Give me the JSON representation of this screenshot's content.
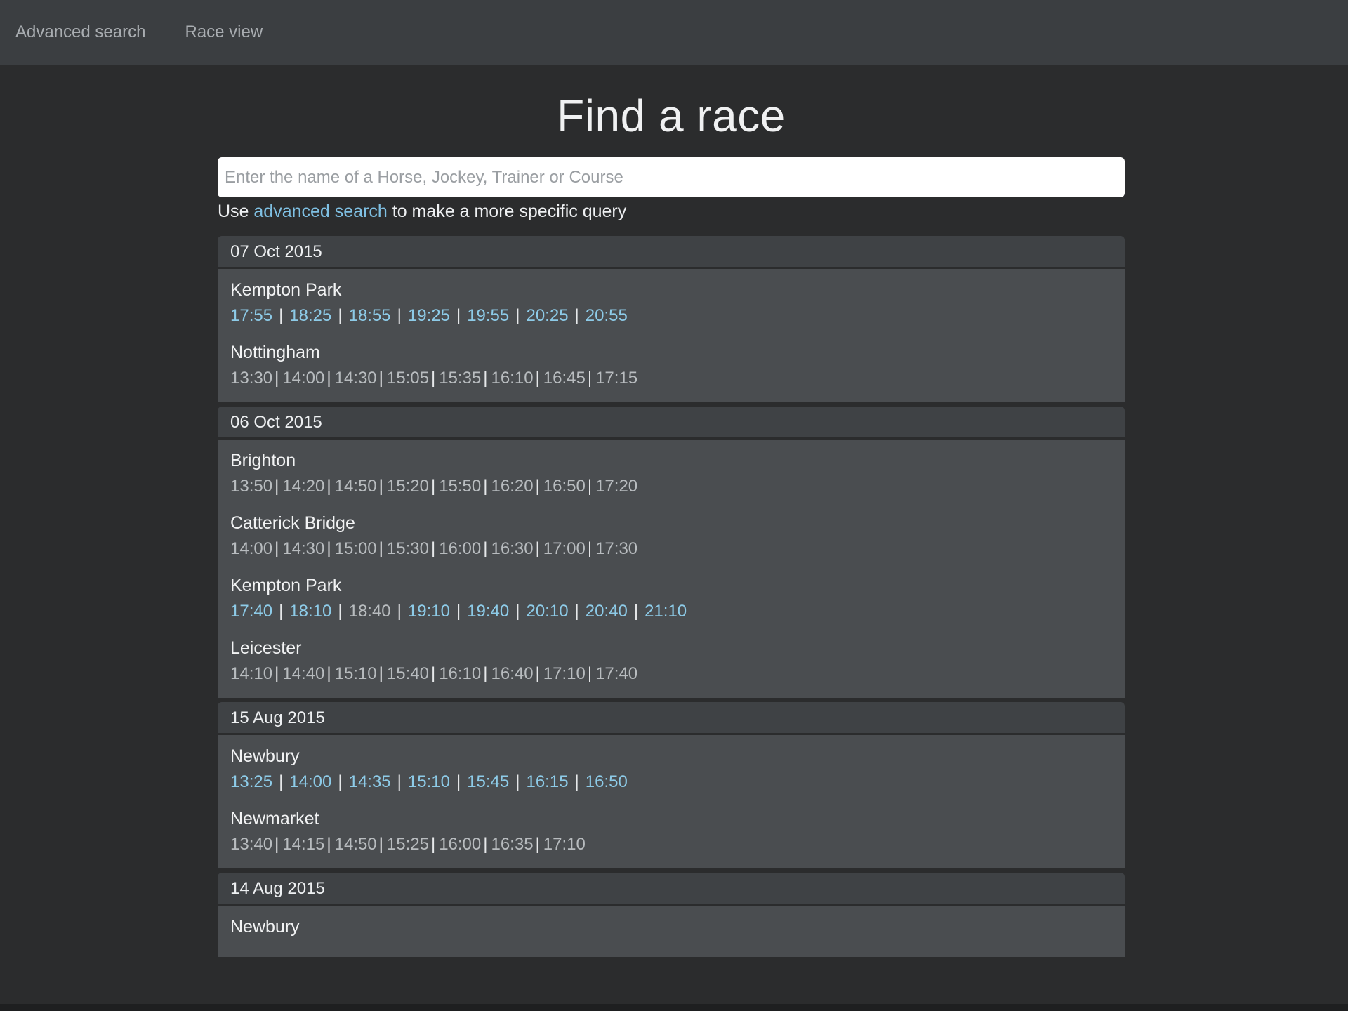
{
  "nav": {
    "items": [
      {
        "label": "Advanced search"
      },
      {
        "label": "Race view"
      }
    ]
  },
  "title": "Find a race",
  "search": {
    "placeholder": "Enter the name of a Horse, Jockey, Trainer or Course",
    "value": ""
  },
  "hint": {
    "prefix": "Use ",
    "link": "advanced search",
    "suffix": " to make a more specific query"
  },
  "days": [
    {
      "date": "07 Oct 2015",
      "courses": [
        {
          "name": "Kempton Park",
          "times": [
            {
              "t": "17:55",
              "link": true
            },
            {
              "t": "18:25",
              "link": true
            },
            {
              "t": "18:55",
              "link": true
            },
            {
              "t": "19:25",
              "link": true
            },
            {
              "t": "19:55",
              "link": true
            },
            {
              "t": "20:25",
              "link": true
            },
            {
              "t": "20:55",
              "link": true
            }
          ]
        },
        {
          "name": "Nottingham",
          "times": [
            {
              "t": "13:30"
            },
            {
              "t": "14:00"
            },
            {
              "t": "14:30"
            },
            {
              "t": "15:05"
            },
            {
              "t": "15:35"
            },
            {
              "t": "16:10"
            },
            {
              "t": "16:45"
            },
            {
              "t": "17:15"
            }
          ]
        }
      ]
    },
    {
      "date": "06 Oct 2015",
      "courses": [
        {
          "name": "Brighton",
          "times": [
            {
              "t": "13:50"
            },
            {
              "t": "14:20"
            },
            {
              "t": "14:50"
            },
            {
              "t": "15:20"
            },
            {
              "t": "15:50"
            },
            {
              "t": "16:20"
            },
            {
              "t": "16:50"
            },
            {
              "t": "17:20"
            }
          ]
        },
        {
          "name": "Catterick Bridge",
          "times": [
            {
              "t": "14:00"
            },
            {
              "t": "14:30"
            },
            {
              "t": "15:00"
            },
            {
              "t": "15:30"
            },
            {
              "t": "16:00"
            },
            {
              "t": "16:30"
            },
            {
              "t": "17:00"
            },
            {
              "t": "17:30"
            }
          ]
        },
        {
          "name": "Kempton Park",
          "times": [
            {
              "t": "17:40",
              "link": true
            },
            {
              "t": "18:10",
              "link": true
            },
            {
              "t": "18:40"
            },
            {
              "t": "19:10",
              "link": true
            },
            {
              "t": "19:40",
              "link": true
            },
            {
              "t": "20:10",
              "link": true
            },
            {
              "t": "20:40",
              "link": true
            },
            {
              "t": "21:10",
              "link": true
            }
          ]
        },
        {
          "name": "Leicester",
          "times": [
            {
              "t": "14:10"
            },
            {
              "t": "14:40"
            },
            {
              "t": "15:10"
            },
            {
              "t": "15:40"
            },
            {
              "t": "16:10"
            },
            {
              "t": "16:40"
            },
            {
              "t": "17:10"
            },
            {
              "t": "17:40"
            }
          ]
        }
      ]
    },
    {
      "date": "15 Aug 2015",
      "courses": [
        {
          "name": "Newbury",
          "times": [
            {
              "t": "13:25",
              "link": true
            },
            {
              "t": "14:00",
              "link": true
            },
            {
              "t": "14:35",
              "link": true
            },
            {
              "t": "15:10",
              "link": true
            },
            {
              "t": "15:45",
              "link": true
            },
            {
              "t": "16:15",
              "link": true
            },
            {
              "t": "16:50",
              "link": true
            }
          ]
        },
        {
          "name": "Newmarket",
          "times": [
            {
              "t": "13:40"
            },
            {
              "t": "14:15"
            },
            {
              "t": "14:50"
            },
            {
              "t": "15:25"
            },
            {
              "t": "16:00"
            },
            {
              "t": "16:35"
            },
            {
              "t": "17:10"
            }
          ]
        }
      ]
    },
    {
      "date": "14 Aug 2015",
      "courses": [
        {
          "name": "Newbury",
          "times": []
        }
      ]
    }
  ],
  "colors": {
    "background": "#2b2c2d",
    "navbar": "#3b3e41",
    "panel": "#4a4d50",
    "link": "#8dcbe8"
  }
}
